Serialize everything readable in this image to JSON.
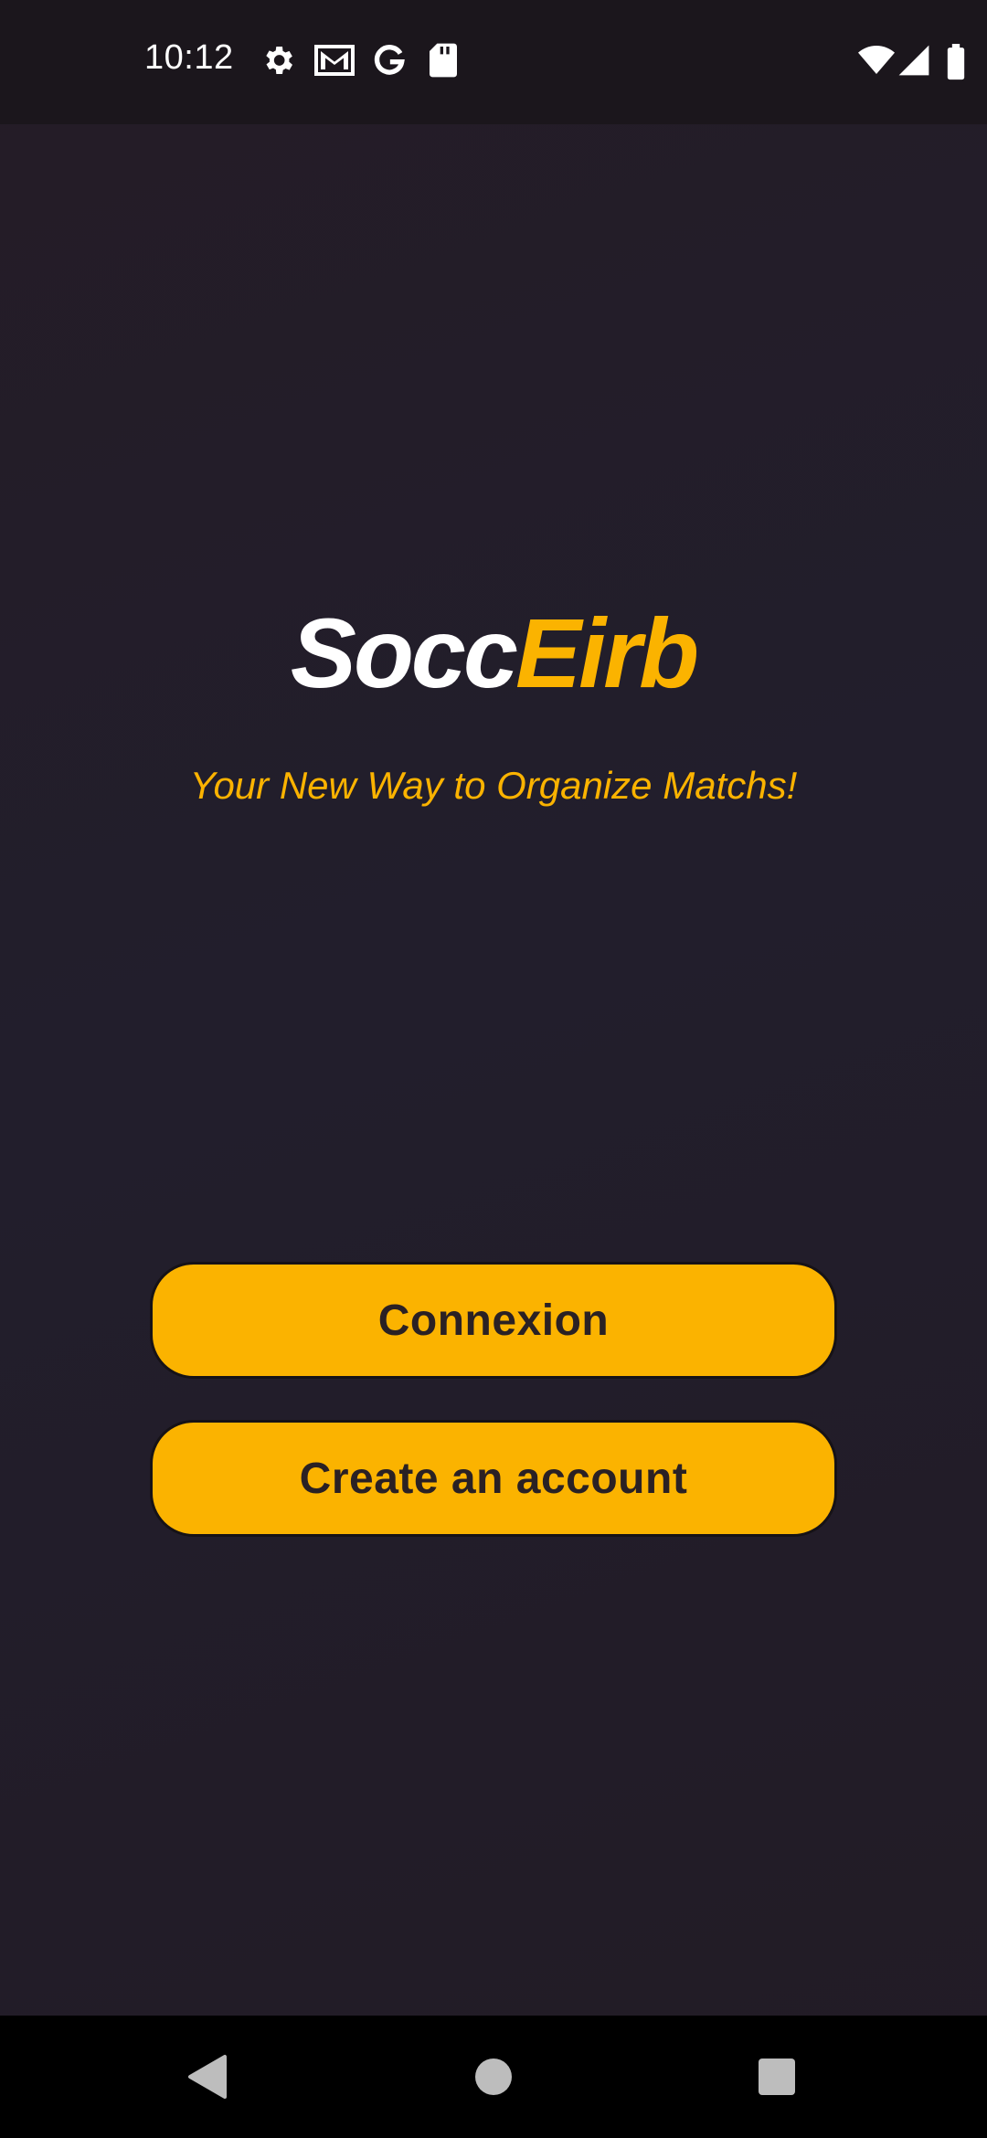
{
  "status_bar": {
    "time": "10:12",
    "left_icons": [
      "gear-icon",
      "gmail-icon",
      "google-icon",
      "sd-card-icon"
    ],
    "right_icons": [
      "wifi-icon",
      "signal-icon",
      "battery-icon"
    ]
  },
  "app": {
    "title_part1": "Socc",
    "title_part2": "Eirb",
    "tagline": "Your New Way to Organize Matchs!",
    "accent_color": "#fbb300",
    "background_color": "#221e2c"
  },
  "buttons": {
    "connexion_label": "Connexion",
    "create_account_label": "Create an account"
  },
  "nav_bar": {
    "icons": [
      "back-icon",
      "home-icon",
      "recents-icon"
    ]
  }
}
